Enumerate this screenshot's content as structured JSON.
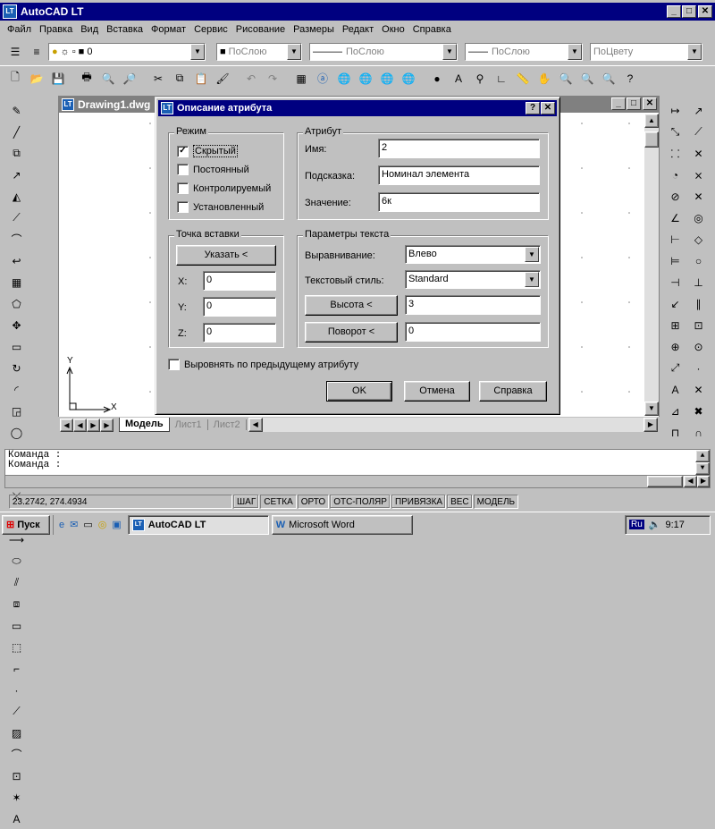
{
  "app": {
    "title": "AutoCAD LT"
  },
  "menu": [
    "Файл",
    "Правка",
    "Вид",
    "Вставка",
    "Формат",
    "Сервис",
    "Рисование",
    "Размеры",
    "Редакт",
    "Окно",
    "Справка"
  ],
  "layer_toolbar": {
    "layer_value": "0",
    "color_value": "ПоСлою",
    "linetype_value": "ПоСлою",
    "lineweight_value": "ПоСлою",
    "plotstyle_value": "ПоЦвету"
  },
  "drawing": {
    "title": "Drawing1.dwg",
    "ucs_x": "X",
    "ucs_y": "Y"
  },
  "dialog": {
    "title": "Описание атрибута",
    "help_glyph": "?",
    "close_glyph": "✕",
    "mode": {
      "label": "Режим",
      "invisible": "Скрытый",
      "constant": "Постоянный",
      "verify": "Контролируемый",
      "preset": "Установленный"
    },
    "attribute": {
      "label": "Атрибут",
      "tag_label": "Имя:",
      "tag_value": "2",
      "prompt_label": "Подсказка:",
      "prompt_value": "Номинал элемента",
      "value_label": "Значение:",
      "value_value": "6к"
    },
    "insertion": {
      "label": "Точка вставки",
      "pick_button": "Указать <",
      "x_label": "X:",
      "x_value": "0",
      "y_label": "Y:",
      "y_value": "0",
      "z_label": "Z:",
      "z_value": "0"
    },
    "text_options": {
      "label": "Параметры текста",
      "justify_label": "Выравнивание:",
      "justify_value": "Влево",
      "style_label": "Текстовый стиль:",
      "style_value": "Standard",
      "height_button": "Высота <",
      "height_value": "3",
      "rotation_button": "Поворот <",
      "rotation_value": "0"
    },
    "align_below": "Выровнять по предыдущему атрибуту",
    "ok": "OK",
    "cancel": "Отмена",
    "help": "Справка"
  },
  "tabs": {
    "model": "Модель",
    "layout1": "Лист1",
    "layout2": "Лист2"
  },
  "command": {
    "line1": "Команда :",
    "line2": "Команда :"
  },
  "status": {
    "coords": "23.2742,  274.4934",
    "snap": "ШАГ",
    "grid": "СЕТКА",
    "ortho": "ОРТО",
    "polar": "ОТС-ПОЛЯР",
    "osnap": "ПРИВЯЗКА",
    "lwt": "ВЕС",
    "model": "МОДЕЛЬ"
  },
  "taskbar": {
    "start": "Пуск",
    "task1": "AutoCAD LT",
    "task2": "Microsoft Word",
    "lang": "Ru",
    "time": "9:17"
  },
  "colors": {
    "title_active": "#000080",
    "title_inactive": "#808080",
    "face": "#c0c0c0"
  }
}
